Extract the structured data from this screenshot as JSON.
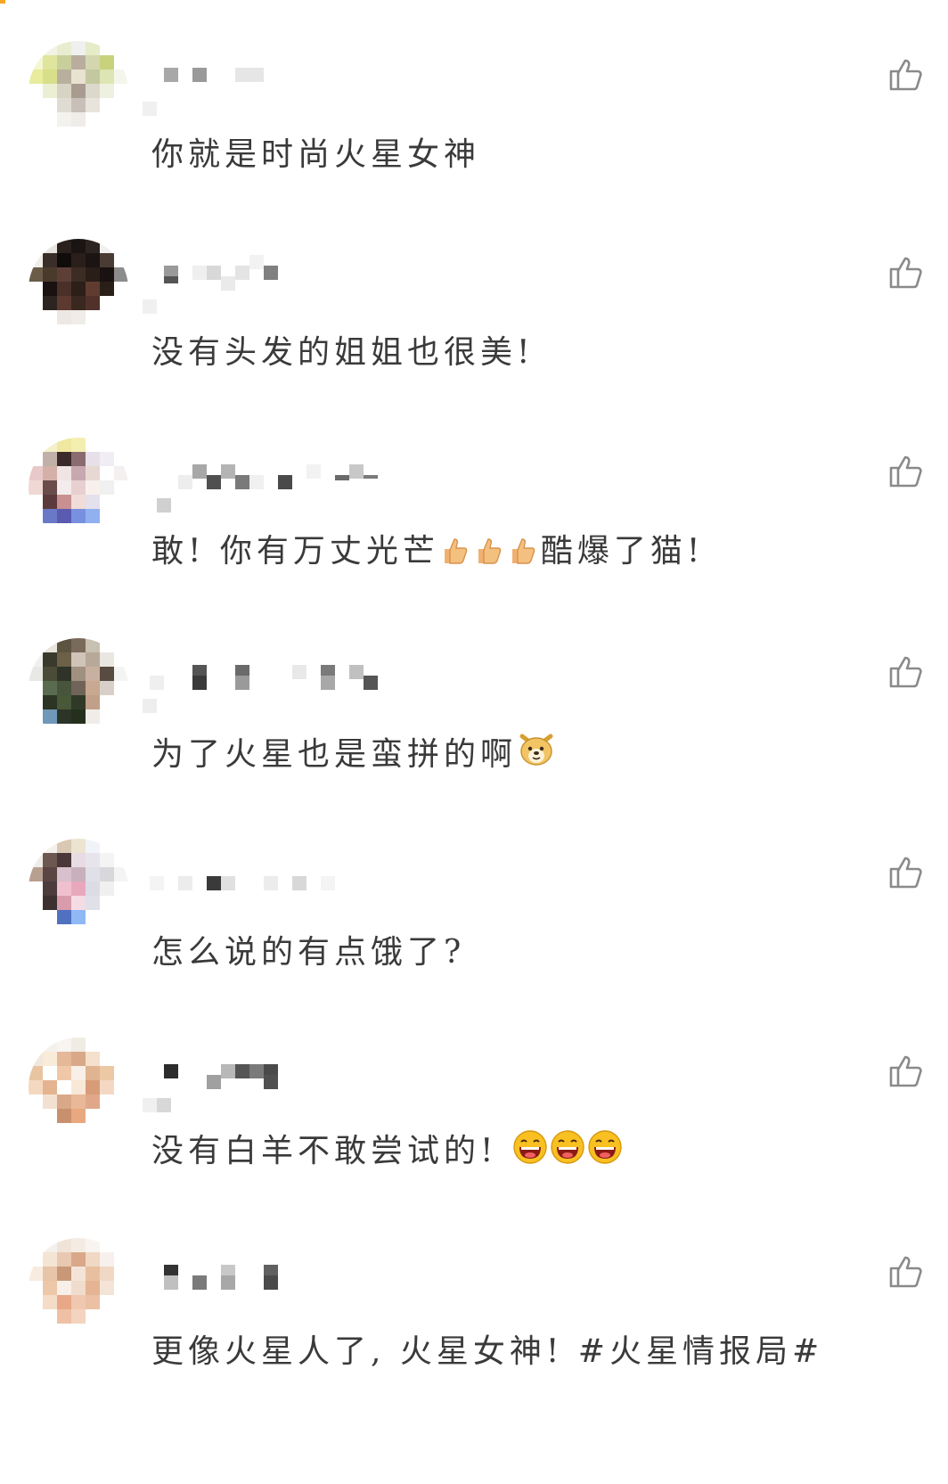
{
  "comments": [
    {
      "text": "你就是时尚火星女神",
      "emojis": []
    },
    {
      "text": "没有头发的姐姐也很美!",
      "emojis": []
    },
    {
      "text_before": "敢! 你有万丈光芒",
      "emojis": [
        "thumbs-up",
        "thumbs-up",
        "thumbs-up"
      ],
      "text_after": "酷爆了猫!"
    },
    {
      "text_before": "为了火星也是蛮拼的啊",
      "emojis": [
        "doge"
      ],
      "text_after": ""
    },
    {
      "text": "怎么说的有点饿了?",
      "emojis": []
    },
    {
      "text_before": "没有白羊不敢尝试的! ",
      "emojis": [
        "laughing-face",
        "laughing-face",
        "laughing-face"
      ],
      "text_after": ""
    },
    {
      "text": "更像火星人了, 火星女神! #火星情报局#",
      "emojis": []
    }
  ],
  "colors": {
    "text": "#3a3a3a",
    "like_icon": "#8a8a8a",
    "accent": "#f5a623"
  },
  "icons": {
    "like": "thumbs-up-outline-icon"
  }
}
